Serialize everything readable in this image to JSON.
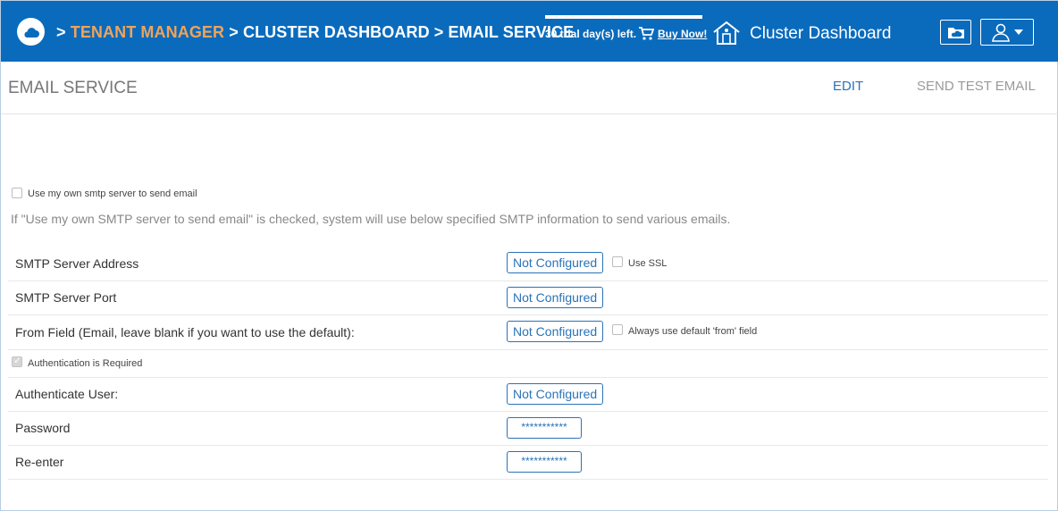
{
  "breadcrumb": {
    "sep": ">",
    "tenant_manager": "TENANT MANAGER",
    "cluster_dashboard": "CLUSTER DASHBOARD",
    "email_service": "EMAIL SERVICE"
  },
  "trial": {
    "text": "30 trial day(s) left.",
    "buy_now": "Buy Now!"
  },
  "header_title": "Cluster Dashboard",
  "page": {
    "title": "EMAIL SERVICE",
    "edit": "EDIT",
    "send_test": "SEND TEST EMAIL"
  },
  "smtp": {
    "own_server_label": "Use my own smtp server to send email",
    "own_server_checked": false,
    "info": "If \"Use my own SMTP server to send email\" is checked, system will use below specified SMTP information to send various emails."
  },
  "rows": {
    "server_address": {
      "label": "SMTP Server Address",
      "value": "Not Configured",
      "extra": "Use SSL"
    },
    "server_port": {
      "label": "SMTP Server Port",
      "value": "Not Configured"
    },
    "from_field": {
      "label": "From Field (Email, leave blank if you want to use the default):",
      "value": "Not Configured",
      "extra": "Always use default 'from' field"
    },
    "auth_required": {
      "label": "Authentication is Required",
      "checked": true
    },
    "auth_user": {
      "label": "Authenticate User:",
      "value": "Not Configured"
    },
    "password": {
      "label": "Password",
      "value": "***********"
    },
    "reenter": {
      "label": "Re-enter",
      "value": "***********"
    }
  },
  "colors": {
    "header_bg": "#0a6bbd",
    "accent_orange": "#f0a35a",
    "link_blue": "#2a73b8"
  }
}
